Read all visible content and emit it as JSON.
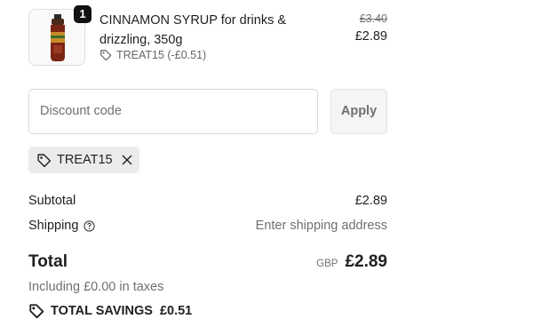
{
  "line_item": {
    "quantity": "1",
    "title": "CINNAMON SYRUP for drinks & drizzling, 350g",
    "discount_label": "TREAT15 (-£0.51)",
    "original_price": "£3.40",
    "price": "£2.89",
    "image_icon": "syrup-bottle-icon"
  },
  "discount": {
    "placeholder": "Discount code",
    "apply_label": "Apply",
    "applied_code": "TREAT15"
  },
  "summary": {
    "subtotal_label": "Subtotal",
    "subtotal_value": "£2.89",
    "shipping_label": "Shipping",
    "shipping_value": "Enter shipping address",
    "total_label": "Total",
    "currency": "GBP",
    "total_value": "£2.89",
    "taxes_note": "Including £0.00 in taxes",
    "savings_label": "TOTAL SAVINGS",
    "savings_value": "£0.51"
  },
  "colors": {
    "text": "#1f1f1f",
    "muted": "#707070",
    "badge": "#111111",
    "chip_bg": "#ebebeb",
    "button_bg": "#f5f5f5"
  }
}
